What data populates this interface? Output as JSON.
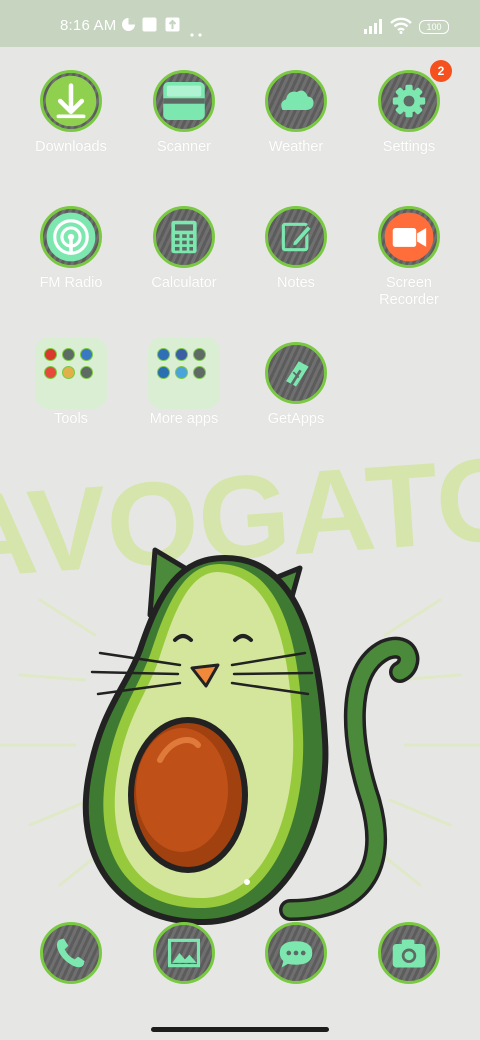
{
  "status_bar": {
    "time": "8:16 AM",
    "battery": "100",
    "icons": [
      "notification-app-icon",
      "square-notification-icon",
      "download-notification-icon",
      "more-dots-icon",
      "signal-icon",
      "wifi-icon",
      "battery-icon"
    ]
  },
  "apps": [
    {
      "label": "Downloads",
      "icon": "download-arrow-icon"
    },
    {
      "label": "Scanner",
      "icon": "scanner-icon"
    },
    {
      "label": "Weather",
      "icon": "cloud-icon"
    },
    {
      "label": "Settings",
      "icon": "gear-icon",
      "badge": "2"
    },
    {
      "label": "FM Radio",
      "icon": "radio-icon"
    },
    {
      "label": "Calculator",
      "icon": "calculator-icon"
    },
    {
      "label": "Notes",
      "icon": "note-pencil-icon"
    },
    {
      "label": "Screen Recorder",
      "icon": "video-camera-icon"
    },
    {
      "label": "Tools",
      "icon": "folder-icon"
    },
    {
      "label": "More apps",
      "icon": "folder-icon"
    },
    {
      "label": "GetApps",
      "icon": "tag-icon"
    }
  ],
  "dock": [
    {
      "name": "phone",
      "icon": "phone-icon"
    },
    {
      "name": "gallery",
      "icon": "image-icon"
    },
    {
      "name": "messages",
      "icon": "chat-bubble-icon"
    },
    {
      "name": "camera",
      "icon": "camera-icon"
    }
  ],
  "wallpaper": {
    "text": "AVOGATO"
  },
  "colors": {
    "accent": "#7ac943",
    "icon_glyph": "#7ce8b0",
    "badge": "#f4511e",
    "status_bar": "#c6d4c0",
    "background": "#e6e7e4"
  }
}
